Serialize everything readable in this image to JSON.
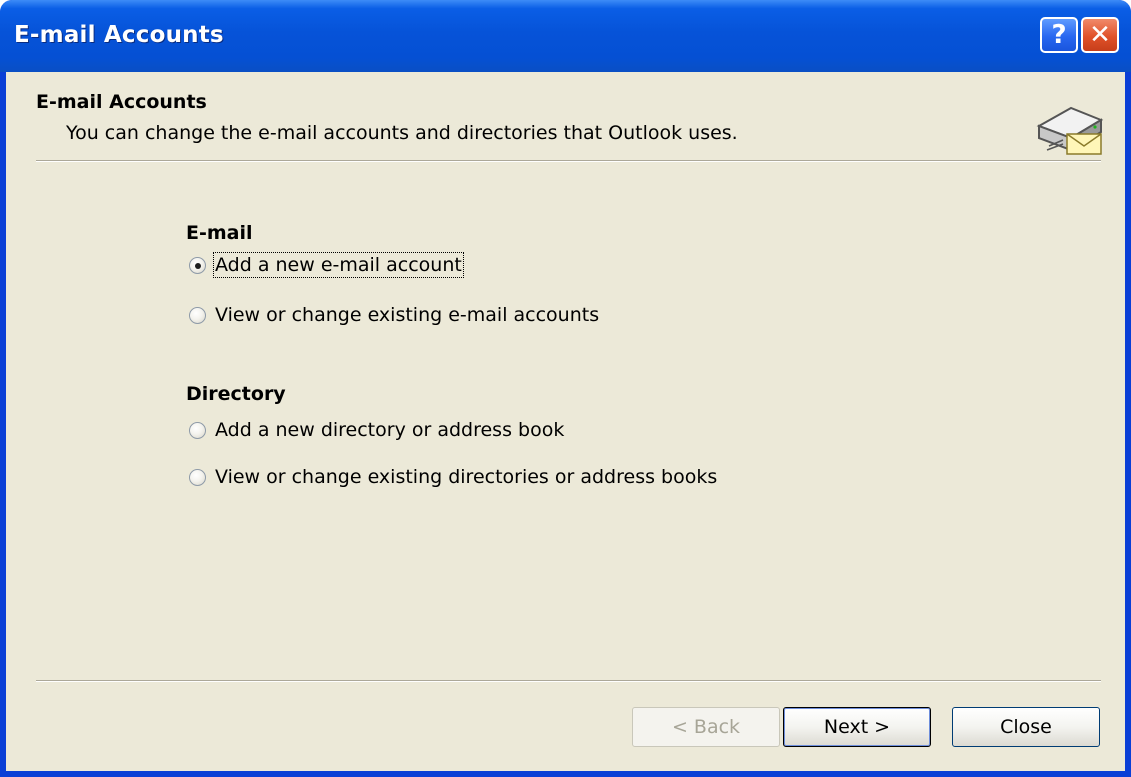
{
  "window": {
    "title": "E-mail Accounts",
    "help_label": "?",
    "close_label": "✕"
  },
  "header": {
    "title": "E-mail Accounts",
    "subtitle": "You can change the e-mail accounts and directories that Outlook uses."
  },
  "email_section": {
    "label": "E-mail",
    "options": [
      {
        "label": "Add a new e-mail account",
        "selected": true
      },
      {
        "label": "View or change existing e-mail accounts",
        "selected": false
      }
    ]
  },
  "directory_section": {
    "label": "Directory",
    "options": [
      {
        "label": "Add a new directory or address book",
        "selected": false
      },
      {
        "label": "View or change existing directories or address books",
        "selected": false
      }
    ]
  },
  "buttons": {
    "back": "< Back",
    "next": "Next >",
    "close": "Close"
  },
  "icons": {
    "header": "email-server-icon",
    "help": "help-icon",
    "close": "close-icon"
  },
  "colors": {
    "titlebar": "#0653d8",
    "dialog_bg": "#ece9d8",
    "close_button": "#e0522a"
  }
}
